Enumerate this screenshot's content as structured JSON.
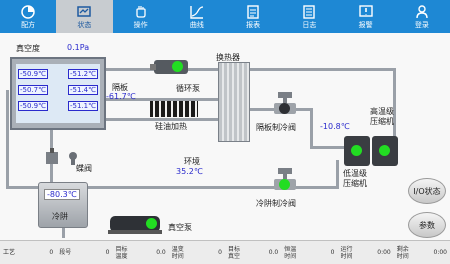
{
  "nav": {
    "items": [
      {
        "label": "配方",
        "icon": "pie-chart-icon"
      },
      {
        "label": "状态",
        "icon": "status-icon",
        "active": true
      },
      {
        "label": "操作",
        "icon": "hand-icon"
      },
      {
        "label": "曲线",
        "icon": "curve-icon"
      },
      {
        "label": "报表",
        "icon": "report-icon"
      },
      {
        "label": "日志",
        "icon": "log-icon"
      },
      {
        "label": "报警",
        "icon": "alarm-icon"
      },
      {
        "label": "登录",
        "icon": "login-icon"
      }
    ]
  },
  "diagram": {
    "vacuum_label": "真空度",
    "vacuum_value": "0.1Pa",
    "chamber_temps": [
      [
        "-50.9℃",
        "-51.2℃"
      ],
      [
        "-50.7℃",
        "-51.4℃"
      ],
      [
        "-50.9℃",
        "-51.1℃"
      ]
    ],
    "partition_label": "隔板",
    "partition_temp": "-61.7℃",
    "circ_pump_label": "循环泵",
    "oil_heat_label": "硅油加热",
    "hx_label": "换热器",
    "partition_cool_valve_label": "隔板制冷阀",
    "hp_comp_temp": "-10.8℃",
    "hp_comp_label": "高温级\n压缩机",
    "lp_comp_label": "低温级\n压缩机",
    "butterfly_valve_label": "蝶阀",
    "ambient_label": "环境",
    "ambient_temp": "35.2℃",
    "trap_cool_valve_label": "冷阱制冷阀",
    "cold_trap_temp": "-80.3℃",
    "cold_trap_label": "冷阱",
    "vacuum_pump_label": "真空泵"
  },
  "side": {
    "io_state_label": "I/O状态",
    "params_label": "参数"
  },
  "status": [
    {
      "label": "工艺",
      "value": "0"
    },
    {
      "label": "段号",
      "value": "0"
    },
    {
      "label": "目标\n温度",
      "value": "0.0"
    },
    {
      "label": "温变\n时间",
      "value": "0"
    },
    {
      "label": "目标\n真空",
      "value": "0.0"
    },
    {
      "label": "恒温\n时间",
      "value": "0"
    },
    {
      "label": "运行\n时间",
      "value": "0:00"
    },
    {
      "label": "剩余\n时间",
      "value": "0:00"
    }
  ],
  "colors": {
    "nav_bg": "#1e88d4",
    "value_text": "#2a2acc",
    "run_indicator": "#22dd22"
  }
}
